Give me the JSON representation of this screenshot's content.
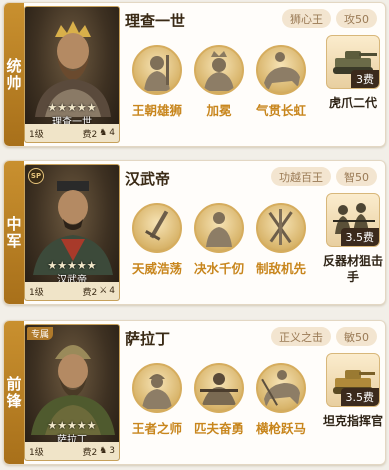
{
  "generals": [
    {
      "role": "统帅",
      "name": "理查一世",
      "portrait_name": "理查一世",
      "stars": "★★★★★",
      "level": "1级",
      "cost": "费2",
      "troops": "4",
      "tag": "",
      "trait": "狮心王",
      "stat": "攻50",
      "skills": [
        "王朝雄狮",
        "加冕",
        "气贯长虹"
      ],
      "unit": {
        "name": "虎爪二代",
        "cost": "3费"
      }
    },
    {
      "role": "中军",
      "name": "汉武帝",
      "portrait_name": "汉武帝",
      "stars": "★★★★★",
      "level": "1级",
      "cost": "费2",
      "troops": "4",
      "tag": "SP",
      "trait": "功越百王",
      "stat": "智50",
      "skills": [
        "天威浩荡",
        "决水千仞",
        "制敌机先"
      ],
      "unit": {
        "name": "反器材狙击手",
        "cost": "3.5费"
      }
    },
    {
      "role": "前锋",
      "name": "萨拉丁",
      "portrait_name": "萨拉丁",
      "stars": "★★★★★",
      "level": "1级",
      "cost": "费2",
      "troops": "3",
      "tag": "专属",
      "trait": "正义之击",
      "stat": "敏50",
      "skills": [
        "王者之师",
        "匹夫奋勇",
        "横枪跃马"
      ],
      "unit": {
        "name": "坦克指挥官",
        "cost": "3.5费"
      }
    }
  ],
  "colors": {
    "accent": "#c8861d",
    "role_bg": "#b5801f",
    "pill_bg": "#f3e5d0"
  }
}
